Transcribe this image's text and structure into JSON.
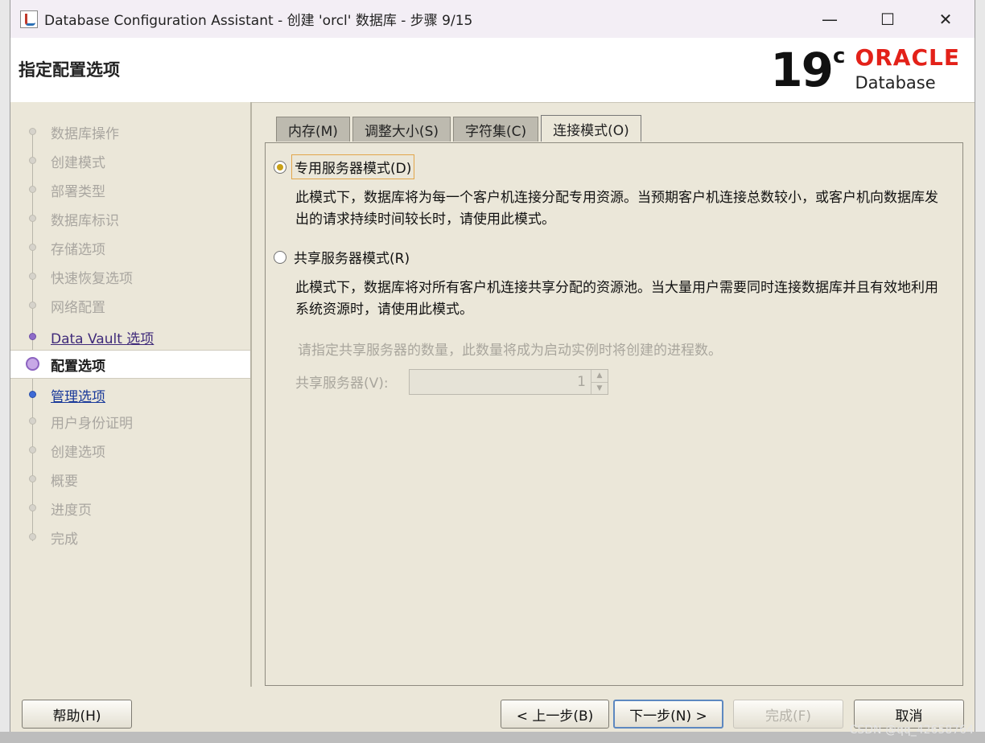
{
  "window": {
    "title": "Database Configuration Assistant - 创建 'orcl' 数据库 - 步骤 9/15",
    "controls": {
      "minimize": "—",
      "maximize": "☐",
      "close": "✕"
    }
  },
  "header": {
    "page_title": "指定配置选项",
    "logo": {
      "version": "19",
      "version_sup": "c",
      "brand": "ORACLE",
      "product": "Database",
      "brand_color": "#e32119"
    }
  },
  "nav": {
    "items": [
      {
        "label": "数据库操作",
        "state": "disabled"
      },
      {
        "label": "创建模式",
        "state": "disabled"
      },
      {
        "label": "部署类型",
        "state": "disabled"
      },
      {
        "label": "数据库标识",
        "state": "disabled"
      },
      {
        "label": "存储选项",
        "state": "disabled"
      },
      {
        "label": "快速恢复选项",
        "state": "disabled"
      },
      {
        "label": "网络配置",
        "state": "disabled"
      },
      {
        "label": "Data Vault 选项",
        "state": "visited"
      },
      {
        "label": "配置选项",
        "state": "current"
      },
      {
        "label": "管理选项",
        "state": "next"
      },
      {
        "label": "用户身份证明",
        "state": "disabled"
      },
      {
        "label": "创建选项",
        "state": "disabled"
      },
      {
        "label": "概要",
        "state": "disabled"
      },
      {
        "label": "进度页",
        "state": "disabled"
      },
      {
        "label": "完成",
        "state": "disabled"
      }
    ]
  },
  "tabs": [
    {
      "label": "内存(M)",
      "active": false
    },
    {
      "label": "调整大小(S)",
      "active": false
    },
    {
      "label": "字符集(C)",
      "active": false
    },
    {
      "label": "连接模式(O)",
      "active": true
    }
  ],
  "connection": {
    "dedicated_label": "专用服务器模式(D)",
    "dedicated_desc": "此模式下，数据库将为每一个客户机连接分配专用资源。当预期客户机连接总数较小，或客户机向数据库发出的请求持续时间较长时，请使用此模式。",
    "shared_label": "共享服务器模式(R)",
    "shared_desc": "此模式下，数据库将对所有客户机连接共享分配的资源池。当大量用户需要同时连接数据库并且有效地利用系统资源时，请使用此模式。",
    "shared_hint": "请指定共享服务器的数量，此数量将成为启动实例时将创建的进程数。",
    "shared_servers_label": "共享服务器(V):",
    "shared_servers_value": "1",
    "selected": "dedicated"
  },
  "buttons": {
    "help": "帮助(H)",
    "back": "< 上一步(B)",
    "next": "下一步(N) >",
    "finish": "完成(F)",
    "cancel": "取消"
  },
  "watermark": "CSDN @qq_42658764"
}
